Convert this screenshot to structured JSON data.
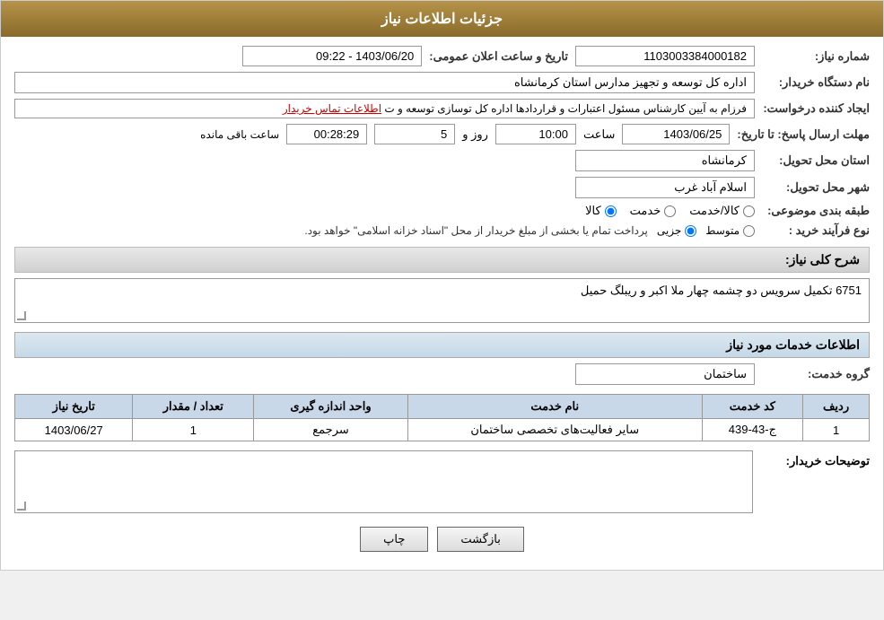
{
  "header": {
    "title": "جزئیات اطلاعات نیاز"
  },
  "fields": {
    "need_number_label": "شماره نیاز:",
    "need_number_value": "1103003384000182",
    "announce_date_label": "تاریخ و ساعت اعلان عمومی:",
    "announce_date_value": "1403/06/20 - 09:22",
    "buyer_org_label": "نام دستگاه خریدار:",
    "buyer_org_value": "اداره کل توسعه  و تجهیز مدارس استان کرمانشاه",
    "creator_label": "ایجاد کننده درخواست:",
    "creator_value": "فرزام به آیین کارشناس مسئول اعتبارات و قراردادها اداره کل توسازی  توسعه و ت",
    "creator_link": "اطلاعات تماس خریدار",
    "response_deadline_label": "مهلت ارسال پاسخ: تا تاریخ:",
    "response_date_value": "1403/06/25",
    "response_time_label": "ساعت",
    "response_time_value": "10:00",
    "response_days_label": "روز و",
    "response_days_value": "5",
    "remaining_label": "ساعت باقی مانده",
    "remaining_value": "00:28:29",
    "province_label": "استان محل تحویل:",
    "province_value": "کرمانشاه",
    "city_label": "شهر محل تحویل:",
    "city_value": "اسلام آباد غرب",
    "category_label": "طبقه بندی موضوعی:",
    "category_options": [
      "کالا",
      "خدمت",
      "کالا/خدمت"
    ],
    "category_selected": "کالا",
    "process_label": "نوع فرآیند خرید :",
    "process_options": [
      "جزیی",
      "متوسط"
    ],
    "process_note": "پرداخت تمام یا بخشی از مبلغ خریدار از محل \"اسناد خزانه اسلامی\" خواهد بود.",
    "description_label": "شرح کلی نیاز:",
    "description_value": "6751 تکمیل سرویس دو چشمه چهار ملا اکبر و  ریبلگ حمیل"
  },
  "services_section": {
    "title": "اطلاعات خدمات مورد نیاز",
    "group_label": "گروه خدمت:",
    "group_value": "ساختمان",
    "table": {
      "columns": [
        "ردیف",
        "کد خدمت",
        "نام خدمت",
        "واحد اندازه گیری",
        "تعداد / مقدار",
        "تاریخ نیاز"
      ],
      "rows": [
        {
          "row": "1",
          "code": "ج-43-439",
          "name": "سایر فعالیت‌های تخصصی ساختمان",
          "unit": "سرجمع",
          "quantity": "1",
          "date": "1403/06/27"
        }
      ]
    }
  },
  "buyer_desc": {
    "label": "توضیحات خریدار:"
  },
  "buttons": {
    "print": "چاپ",
    "back": "بازگشت"
  }
}
